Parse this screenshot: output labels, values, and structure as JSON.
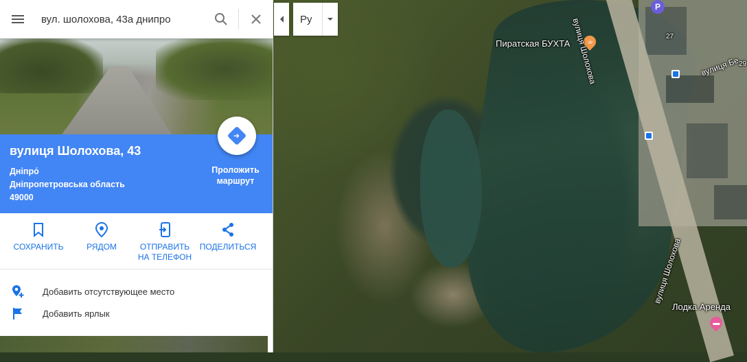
{
  "search": {
    "value": "вул. шолохова, 43а днипро",
    "menu_icon": "menu-icon",
    "search_icon": "search-icon",
    "clear_icon": "close-icon"
  },
  "place": {
    "title": "вулиця Шолохова, 43",
    "city": "Дніпро́",
    "region": "Дніпропетровська область",
    "postal_code": "49000",
    "route_label": "Проложить маршрут"
  },
  "actions": [
    {
      "label": "СОХРАНИТЬ",
      "icon": "bookmark-icon"
    },
    {
      "label": "РЯДОМ",
      "icon": "nearby-icon"
    },
    {
      "label": "ОТПРАВИТЬ НА ТЕЛЕФОН",
      "icon": "send-to-phone-icon"
    },
    {
      "label": "ПОДЕЛИТЬСЯ",
      "icon": "share-icon"
    }
  ],
  "extras": [
    {
      "label": "Добавить отсутствующее место",
      "icon": "add-place-icon"
    },
    {
      "label": "Добавить ярлык",
      "icon": "flag-icon"
    }
  ],
  "language": {
    "selected": "Ру"
  },
  "map": {
    "labels": {
      "poi_bay": "Пиратская БУХТА",
      "poi_boat": "Лодка Аренда",
      "street_1": "вулиця Шолохова",
      "street_2": "вулиця Шолохова",
      "street_3": "вулиця Бе",
      "building_27": "27",
      "building_29": "29",
      "parking": "P"
    }
  },
  "colors": {
    "accent": "#4285f4",
    "link": "#1a73e8",
    "poi_orange": "#f2994a",
    "poi_pink": "#e65c9c",
    "parking_purple": "#6a5fd8"
  }
}
